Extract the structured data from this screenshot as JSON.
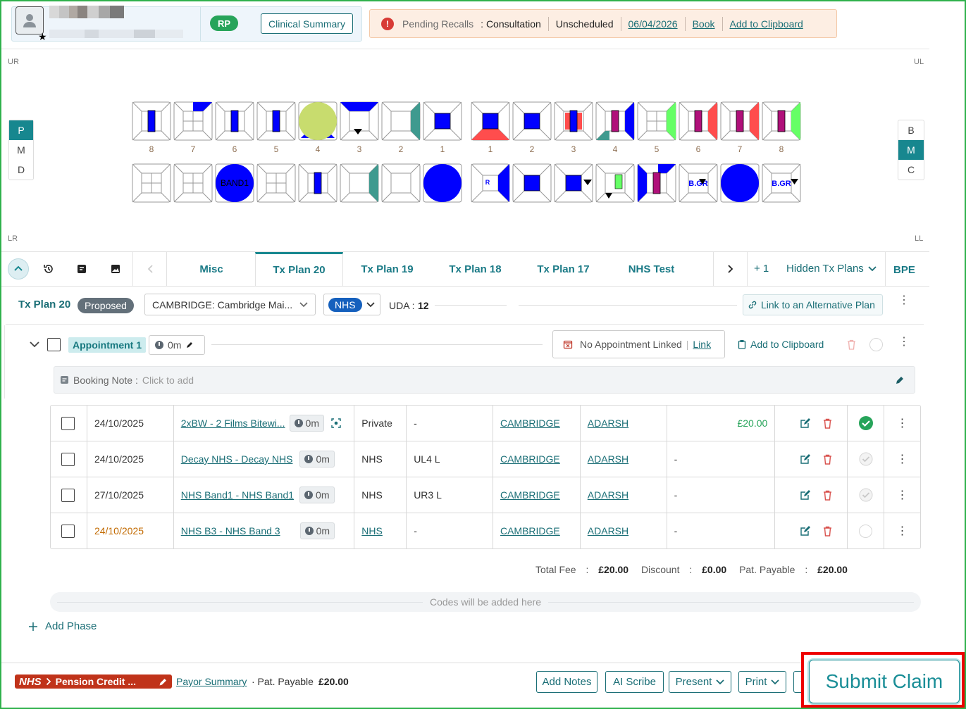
{
  "header": {
    "badge": "RP",
    "clinical_summary": "Clinical Summary",
    "recall": {
      "label": "Pending Recalls",
      "type": ": Consultation",
      "status": "Unscheduled",
      "date": "06/04/2026",
      "book": "Book",
      "clipboard": "Add to Clipboard"
    }
  },
  "chart": {
    "quadrants": {
      "ur": "UR",
      "ul": "UL",
      "lr": "LR",
      "ll": "LL"
    },
    "view_left": [
      "P",
      "M",
      "D"
    ],
    "view_right": [
      "B",
      "M",
      "C"
    ],
    "upper_numbers": [
      "8",
      "7",
      "6",
      "5",
      "4",
      "3",
      "2",
      "1",
      "1",
      "2",
      "3",
      "4",
      "5",
      "6",
      "7",
      "8"
    ],
    "lower_labels": {
      "band1": "BAND1",
      "r": "R",
      "bgr1": "B.GR",
      "bgr2": "B.GR"
    }
  },
  "tabs": {
    "items": [
      "Misc",
      "Tx Plan 20",
      "Tx Plan 19",
      "Tx Plan 18",
      "Tx Plan 17",
      "NHS Test"
    ],
    "active": "Tx Plan 20",
    "plus_count": "+ 1",
    "hidden": "Hidden Tx Plans",
    "bpe": "BPE"
  },
  "plan": {
    "name": "Tx Plan 20",
    "status": "Proposed",
    "clinic": "CAMBRIDGE: Cambridge Mai...",
    "payor": "NHS",
    "uda_label": "UDA :",
    "uda_value": "12",
    "link_alt": "Link to an Alternative Plan"
  },
  "appointment": {
    "label": "Appointment 1",
    "time": "0m",
    "no_appt": "No Appointment Linked",
    "link": "Link",
    "clipboard": "Add to Clipboard",
    "booking_label": "Booking Note :",
    "booking_placeholder": "Click to add"
  },
  "rows": [
    {
      "date": "24/10/2025",
      "treatment": "2xBW - 2 Films Bitewi...",
      "time": "0m",
      "payor": "Private",
      "tooth": "-",
      "clinic": "CAMBRIDGE",
      "clinician": "ADARSH",
      "fee": "£20.00"
    },
    {
      "date": "24/10/2025",
      "treatment": "Decay NHS - Decay NHS",
      "time": "0m",
      "payor": "NHS",
      "tooth": "UL4 L",
      "clinic": "CAMBRIDGE",
      "clinician": "ADARSH",
      "fee": "-"
    },
    {
      "date": "27/10/2025",
      "treatment": "NHS Band1 - NHS Band1",
      "time": "0m",
      "payor": "NHS",
      "tooth": "UR3 L",
      "clinic": "CAMBRIDGE",
      "clinician": "ADARSH",
      "fee": "-"
    },
    {
      "date": "24/10/2025",
      "treatment": "NHS B3 - NHS Band 3",
      "time": "0m",
      "payor": "NHS",
      "tooth": "-",
      "clinic": "CAMBRIDGE",
      "clinician": "ADARSH",
      "fee": "-"
    }
  ],
  "totals": {
    "total_label": "Total Fee",
    "total": "£20.00",
    "discount_label": "Discount",
    "discount": "£0.00",
    "payable_label": "Pat. Payable",
    "payable": "£20.00",
    "colon": ":"
  },
  "codes_placeholder": "Codes will be added here",
  "add_phase": "Add Phase",
  "footer": {
    "nhs": "NHS",
    "pension": "Pension Credit ...",
    "payor_summary": "Payor Summary",
    "pat_payable_label": "· Pat. Payable",
    "pat_payable": "£20.00",
    "add_notes": "Add Notes",
    "ai_scribe": "AI Scribe",
    "present": "Present",
    "print": "Print",
    "submit": "Submit Claim"
  },
  "colors": {
    "accent": "#17878f",
    "link": "#1a6e76",
    "success": "#27a45a",
    "alert": "#e00000",
    "tooth_blue": "#0000ff",
    "nhs_tag": "#c0331a"
  }
}
